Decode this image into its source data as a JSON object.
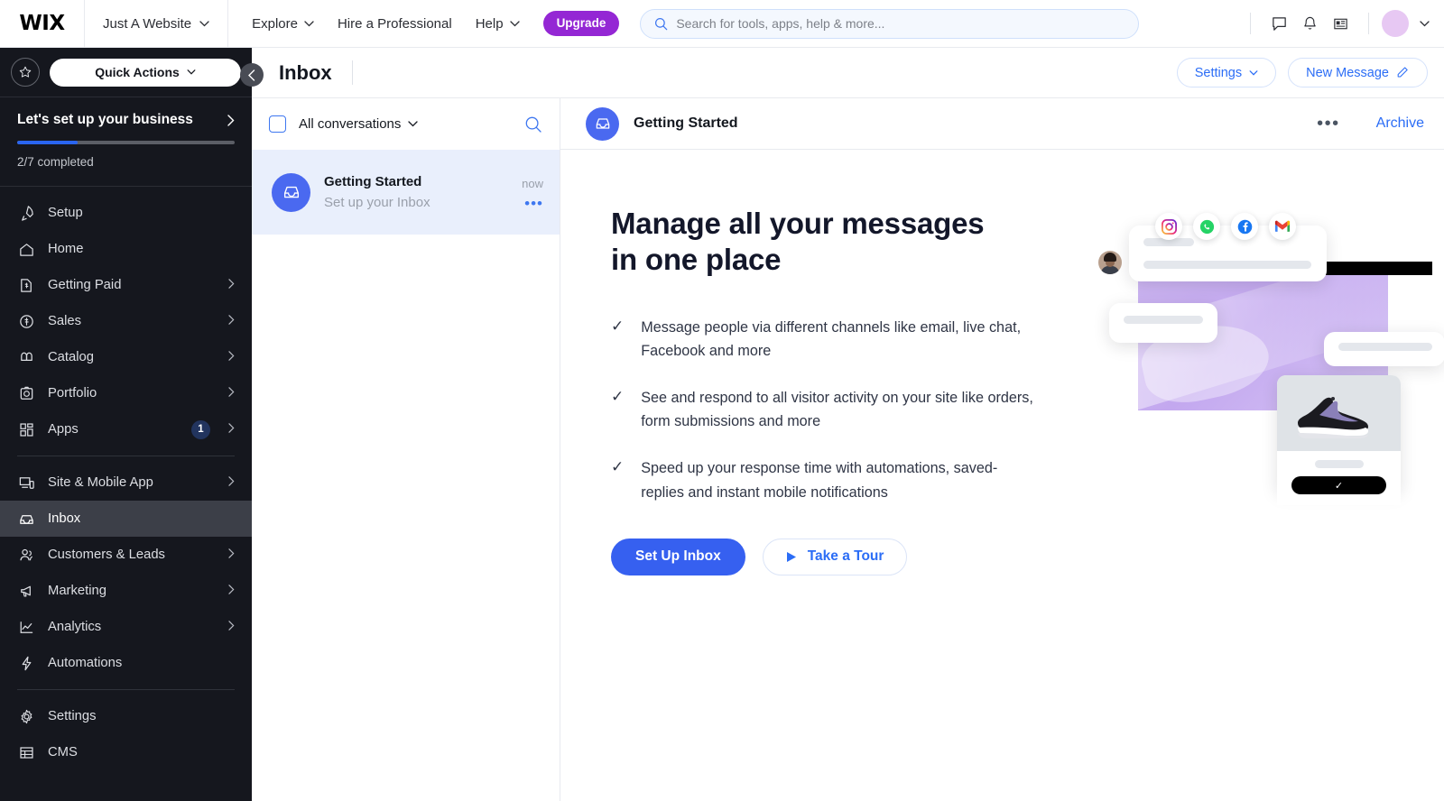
{
  "topbar": {
    "logo": "WIX",
    "site_name": "Just A Website",
    "nav": [
      {
        "label": "Explore",
        "caret": true
      },
      {
        "label": "Hire a Professional",
        "caret": false
      },
      {
        "label": "Help",
        "caret": true
      }
    ],
    "upgrade_label": "Upgrade",
    "search_placeholder": "Search for tools, apps, help & more...",
    "icons": [
      "chat-icon",
      "bell-icon",
      "news-icon"
    ],
    "avatar_color": "#e7c8f3"
  },
  "sidebar": {
    "quick_actions_label": "Quick Actions",
    "setup": {
      "title": "Let's set up your business",
      "progress_label": "2/7 completed",
      "progress_percent": 28,
      "accent": "#2a65f0"
    },
    "items": [
      {
        "label": "Setup",
        "icon": "rocket-icon",
        "chevron": false,
        "badge": null,
        "active": false
      },
      {
        "label": "Home",
        "icon": "home-icon",
        "chevron": false,
        "badge": null,
        "active": false
      },
      {
        "label": "Getting Paid",
        "icon": "invoice-icon",
        "chevron": true,
        "badge": null,
        "active": false
      },
      {
        "label": "Sales",
        "icon": "dollar-circle-icon",
        "chevron": true,
        "badge": null,
        "active": false
      },
      {
        "label": "Catalog",
        "icon": "catalog-icon",
        "chevron": true,
        "badge": null,
        "active": false
      },
      {
        "label": "Portfolio",
        "icon": "portfolio-icon",
        "chevron": true,
        "badge": null,
        "active": false
      },
      {
        "label": "Apps",
        "icon": "apps-icon",
        "chevron": true,
        "badge": "1",
        "active": false
      },
      {
        "label": "Site & Mobile App",
        "icon": "device-icon",
        "chevron": true,
        "badge": null,
        "active": false
      },
      {
        "label": "Inbox",
        "icon": "inbox-icon",
        "chevron": false,
        "badge": null,
        "active": true
      },
      {
        "label": "Customers & Leads",
        "icon": "people-icon",
        "chevron": true,
        "badge": null,
        "active": false
      },
      {
        "label": "Marketing",
        "icon": "megaphone-icon",
        "chevron": true,
        "badge": null,
        "active": false
      },
      {
        "label": "Analytics",
        "icon": "chart-icon",
        "chevron": true,
        "badge": null,
        "active": false
      },
      {
        "label": "Automations",
        "icon": "bolt-icon",
        "chevron": false,
        "badge": null,
        "active": false
      },
      {
        "label": "Settings",
        "icon": "gear-icon",
        "chevron": false,
        "badge": null,
        "active": false
      },
      {
        "label": "CMS",
        "icon": "table-icon",
        "chevron": false,
        "badge": null,
        "active": false
      }
    ]
  },
  "page": {
    "title": "Inbox",
    "settings_label": "Settings",
    "new_message_label": "New Message"
  },
  "conversations": {
    "filter_label": "All conversations",
    "items": [
      {
        "name": "Getting Started",
        "preview": "Set up your Inbox",
        "time": "now",
        "selected": true
      }
    ]
  },
  "thread": {
    "title": "Getting Started",
    "archive_label": "Archive"
  },
  "hero": {
    "heading_line1": "Manage all your messages",
    "heading_line2": "in one place",
    "bullets": [
      "Message people via different channels like email, live chat, Facebook and more",
      "See and respond to all visitor activity on your site like orders, form submissions and more",
      "Speed up your response time with automations, saved-replies and instant mobile notifications"
    ],
    "primary_cta": "Set Up Inbox",
    "secondary_cta": "Take a Tour",
    "illustration_channels": [
      "instagram-icon",
      "whatsapp-icon",
      "facebook-icon",
      "gmail-icon"
    ]
  }
}
